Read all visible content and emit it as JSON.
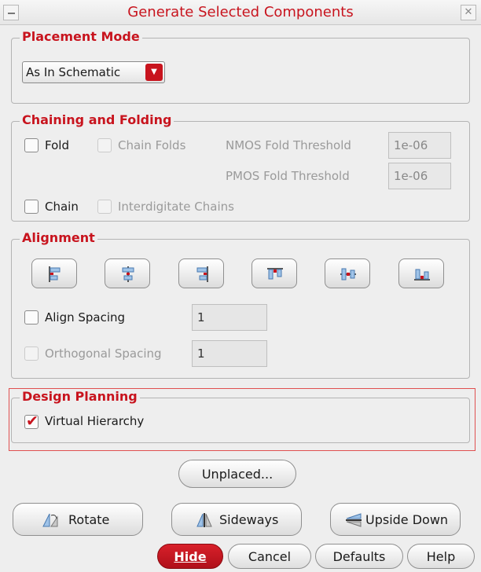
{
  "window": {
    "title": "Generate Selected Components"
  },
  "placement_mode": {
    "legend": "Placement Mode",
    "selected": "As In Schematic"
  },
  "chaining": {
    "legend": "Chaining and Folding",
    "fold_label": "Fold",
    "chain_folds_label": "Chain Folds",
    "nmos_label": "NMOS Fold Threshold",
    "nmos_value": "1e-06",
    "pmos_label": "PMOS Fold Threshold",
    "pmos_value": "1e-06",
    "chain_label": "Chain",
    "interdigitate_label": "Interdigitate Chains"
  },
  "alignment": {
    "legend": "Alignment",
    "buttons": [
      {
        "icon": "align-left-icon"
      },
      {
        "icon": "align-center-horizontal-icon"
      },
      {
        "icon": "align-right-icon"
      },
      {
        "icon": "align-top-icon"
      },
      {
        "icon": "align-middle-vertical-icon"
      },
      {
        "icon": "align-bottom-icon"
      }
    ],
    "align_spacing_label": "Align Spacing",
    "align_spacing_value": "1",
    "orthogonal_spacing_label": "Orthogonal Spacing",
    "orthogonal_spacing_value": "1"
  },
  "design_planning": {
    "legend": "Design Planning",
    "virtual_hierarchy_label": "Virtual Hierarchy",
    "virtual_hierarchy_checked": true
  },
  "unplaced_label": "Unplaced...",
  "actions": {
    "rotate": "Rotate",
    "sideways": "Sideways",
    "upside_down": "Upside Down"
  },
  "footer": {
    "hide": "Hide",
    "cancel": "Cancel",
    "defaults": "Defaults",
    "help": "Help"
  },
  "colors": {
    "accent": "#c8141e",
    "background": "#eeeeee"
  }
}
